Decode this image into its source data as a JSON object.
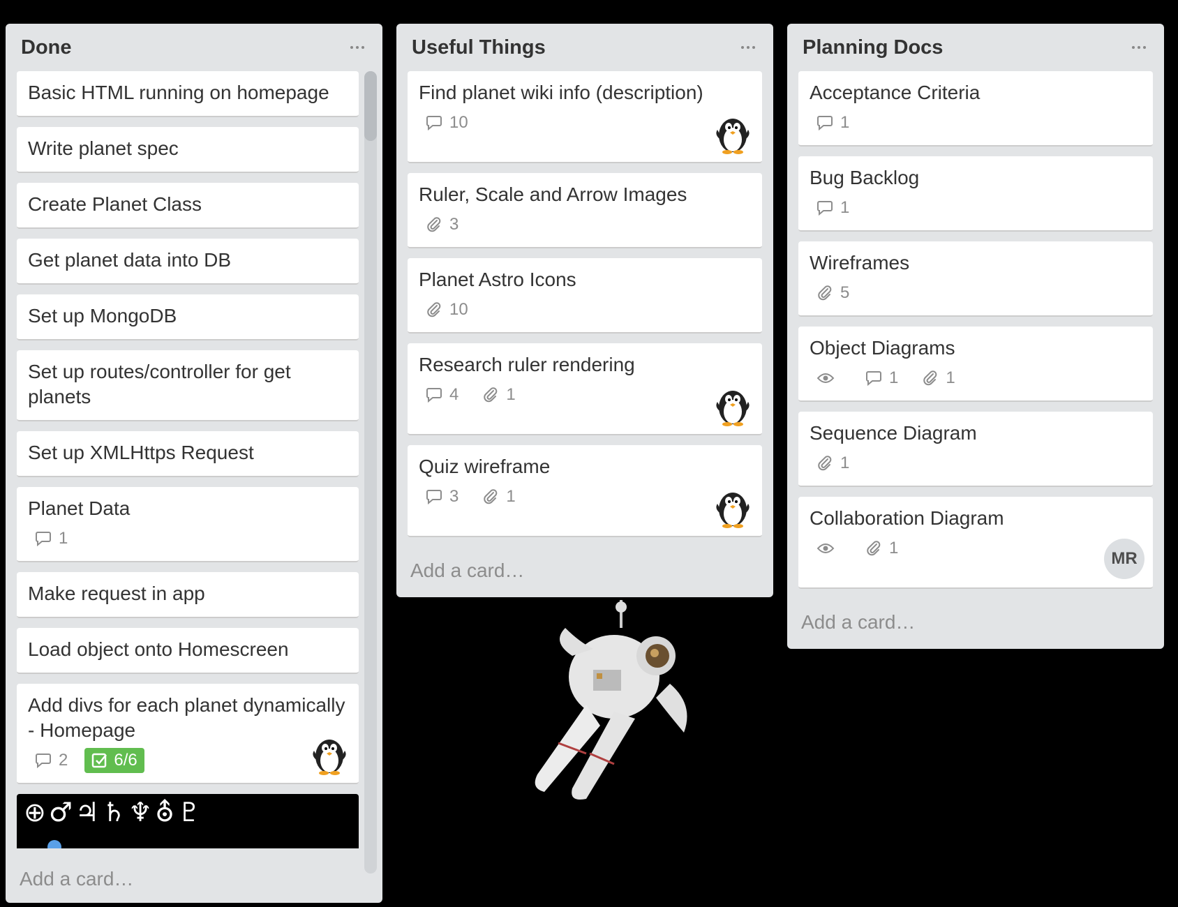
{
  "lists": [
    {
      "title": "Done",
      "add_card": "Add a card…",
      "cards": [
        {
          "title": "Basic HTML running on homepage"
        },
        {
          "title": "Write planet spec"
        },
        {
          "title": "Create Planet Class"
        },
        {
          "title": "Get planet data into DB"
        },
        {
          "title": "Set up MongoDB"
        },
        {
          "title": "Set up routes/controller for get planets"
        },
        {
          "title": "Set up XMLHttps Request"
        },
        {
          "title": "Planet Data",
          "comments": "1"
        },
        {
          "title": "Make request in app"
        },
        {
          "title": "Load object onto Homescreen"
        },
        {
          "title": "Add divs for each planet dynamically - Homepage",
          "comments": "2",
          "checklist": "6/6",
          "avatar": "penguin"
        }
      ],
      "cover_symbols": "⊕♂♃♄♆⛢♇"
    },
    {
      "title": "Useful Things",
      "add_card": "Add a card…",
      "cards": [
        {
          "title": "Find planet wiki info (description)",
          "comments": "10",
          "avatar": "penguin"
        },
        {
          "title": "Ruler, Scale and Arrow Images",
          "attachments": "3"
        },
        {
          "title": "Planet Astro Icons",
          "attachments": "10"
        },
        {
          "title": "Research ruler rendering",
          "comments": "4",
          "attachments": "1",
          "avatar": "penguin"
        },
        {
          "title": "Quiz wireframe",
          "comments": "3",
          "attachments": "1",
          "avatar": "penguin"
        }
      ]
    },
    {
      "title": "Planning Docs",
      "add_card": "Add a card…",
      "cards": [
        {
          "title": "Acceptance Criteria",
          "comments": "1"
        },
        {
          "title": "Bug Backlog",
          "comments": "1"
        },
        {
          "title": "Wireframes",
          "attachments": "5"
        },
        {
          "title": "Object Diagrams",
          "watch": true,
          "comments": "1",
          "attachments": "1"
        },
        {
          "title": "Sequence Diagram",
          "attachments": "1"
        },
        {
          "title": "Collaboration Diagram",
          "watch": true,
          "attachments": "1",
          "avatar_initials": "MR"
        }
      ]
    }
  ],
  "colors": {
    "list_bg": "#e2e4e6",
    "card_bg": "#ffffff",
    "checklist_complete": "#61bd4f",
    "board_bg": "#000000"
  }
}
